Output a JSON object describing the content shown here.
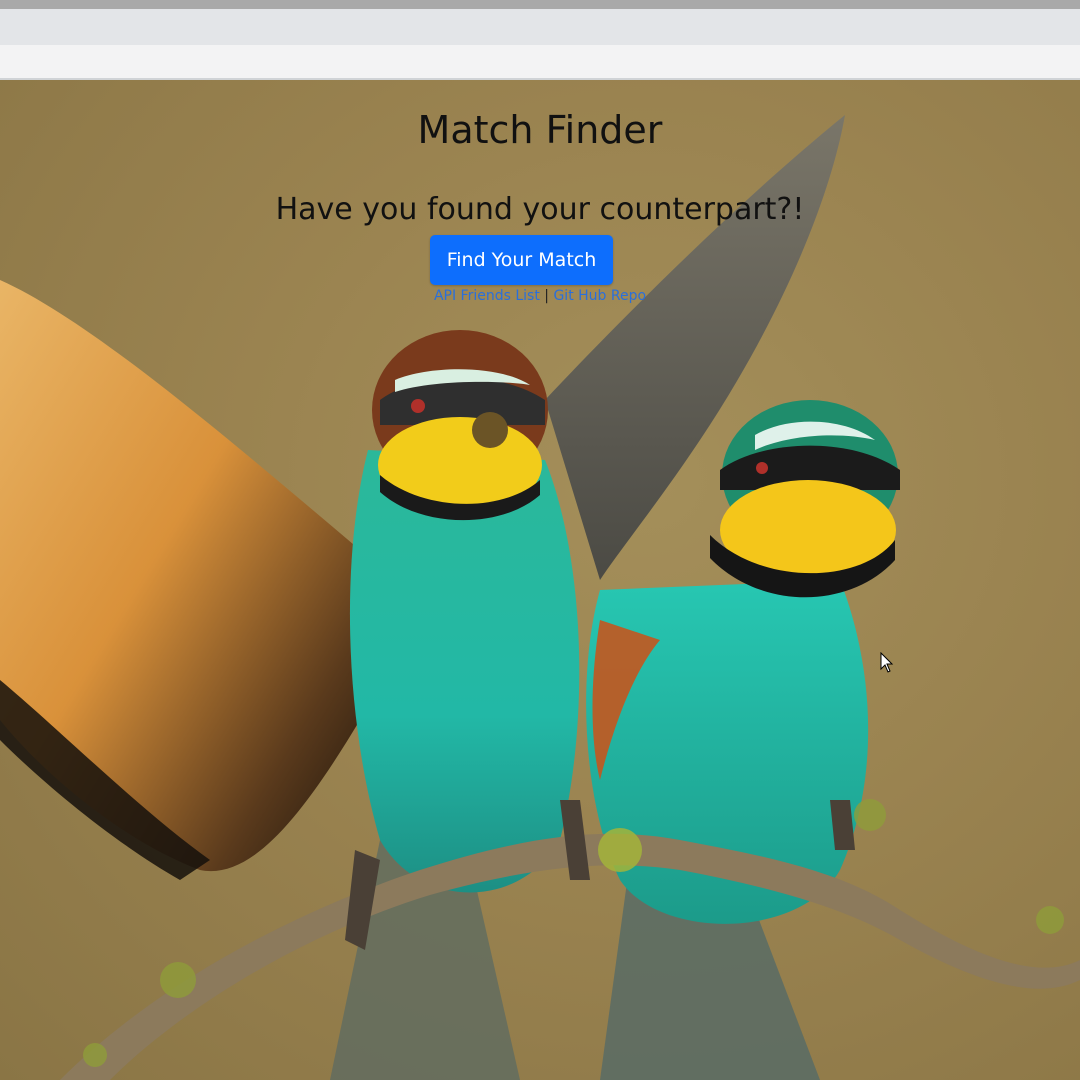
{
  "page": {
    "title": "Match Finder",
    "subtitle": "Have you found your counterpart?!",
    "find_button_label": "Find Your Match",
    "links": {
      "friends_label": "API Friends List",
      "separator": "|",
      "repo_label": "Git Hub Repo"
    }
  },
  "colors": {
    "button_blue": "#0d6efd",
    "link_blue": "#2a6fdb",
    "background_tan": "#9a8350"
  },
  "icons": {
    "cursor": "mouse-pointer-icon"
  }
}
